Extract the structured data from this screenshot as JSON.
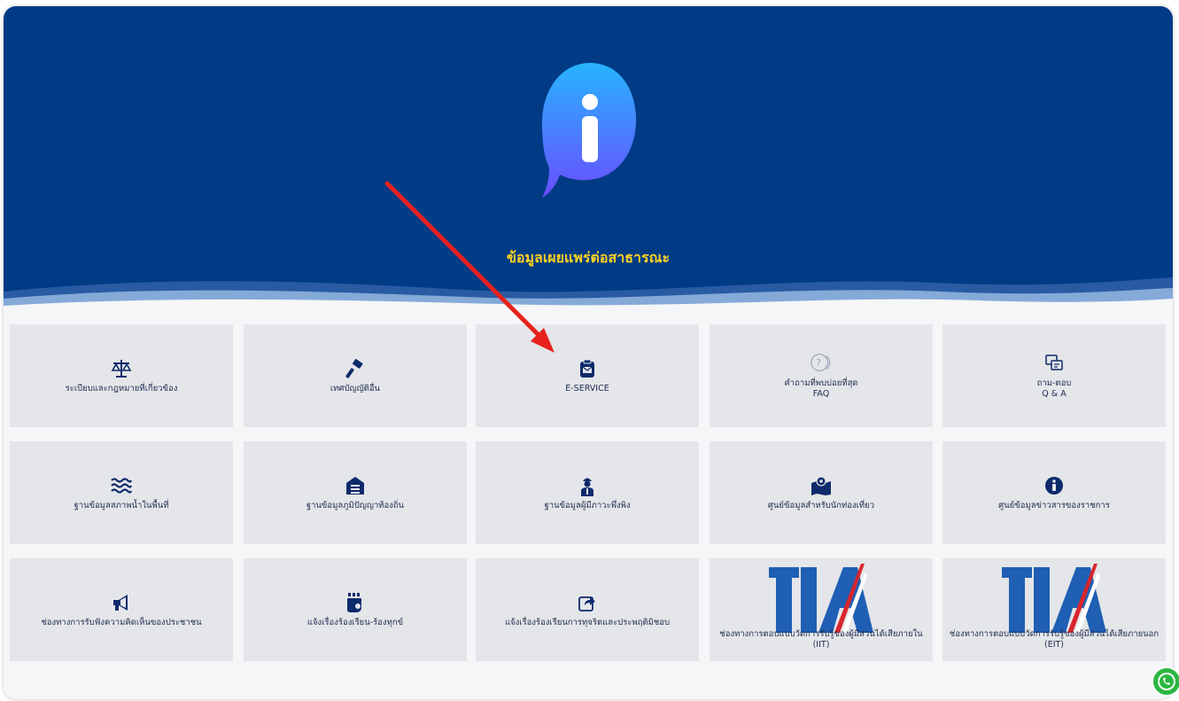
{
  "hero": {
    "title": "ข้อมูลเผยแพร่ต่อสาธารณะ"
  },
  "colors": {
    "hero_bg": "#013b86",
    "title": "#ffd21f",
    "tile_bg": "#e4e6e9",
    "icon": "#0d2a6b",
    "arrow": "#e8211c"
  },
  "tiles": [
    {
      "label": "ระเบียบและกฎหมายที่เกี่ยวข้อง",
      "sub": "",
      "icon": "scale-icon"
    },
    {
      "label": "เทศบัญญัติอื่น",
      "sub": "",
      "icon": "gavel-icon"
    },
    {
      "label": "E-SERVICE",
      "sub": "",
      "icon": "clipboard-envelope-icon"
    },
    {
      "label": "คำถามที่พบบ่อยที่สุด",
      "sub": "FAQ",
      "icon": "question-bubble-icon"
    },
    {
      "label": "ถาม-ตอบ",
      "sub": "Q & A",
      "icon": "chat-bubbles-icon"
    },
    {
      "label": "ฐานข้อมูลสภาพน้ำในพื้นที่",
      "sub": "",
      "icon": "water-icon"
    },
    {
      "label": "ฐานข้อมูลภูมิปัญญาท้องถิ่น",
      "sub": "",
      "icon": "warehouse-icon"
    },
    {
      "label": "ฐานข้อมูลผู้มีภาวะพึ่งพิง",
      "sub": "",
      "icon": "worker-icon"
    },
    {
      "label": "ศูนย์ข้อมูลสำหรับนักท่องเที่ยว",
      "sub": "",
      "icon": "map-pin-icon"
    },
    {
      "label": "ศูนย์ข้อมูลข่าวสารของราชการ",
      "sub": "",
      "icon": "info-circle-icon"
    },
    {
      "label": "ช่องทางการรับฟังความคิดเห็นของประชาชน",
      "sub": "",
      "icon": "megaphone-icon"
    },
    {
      "label": "แจ้งเรื่องร้องเรียน-ร้องทุกข์",
      "sub": "",
      "icon": "fist-icon"
    },
    {
      "label": "แจ้งเรื่องร้องเรียนการทุจริตและประพฤติมิชอบ",
      "sub": "",
      "icon": "share-icon"
    },
    {
      "label": "ช่องทางการตอบแบบวัดการรับรู้ของผู้มีส่วนได้เสียภายใน (IIT)",
      "sub": "",
      "icon": "ita-logo"
    },
    {
      "label": "ช่องทางการตอบแบบวัดการรับรู้ของผู้มีส่วนได้เสียภายนอก",
      "sub": "(EIT)",
      "icon": "ita-logo"
    }
  ]
}
